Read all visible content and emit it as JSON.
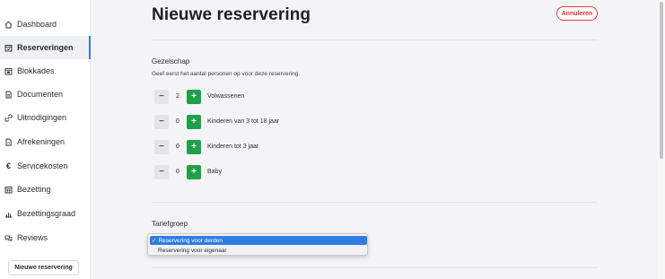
{
  "sidebar": {
    "items": [
      {
        "label": "Dashboard",
        "icon": "home-icon"
      },
      {
        "label": "Reserveringen",
        "icon": "calendar-check-icon"
      },
      {
        "label": "Blokkades",
        "icon": "calendar-block-icon"
      },
      {
        "label": "Documenten",
        "icon": "document-icon"
      },
      {
        "label": "Uitnodigingen",
        "icon": "link-icon"
      },
      {
        "label": "Afrekeningen",
        "icon": "receipt-icon"
      },
      {
        "label": "Servicekosten",
        "icon": "euro-icon"
      },
      {
        "label": "Bezetting",
        "icon": "calendar-grid-icon"
      },
      {
        "label": "Bezettingsgraad",
        "icon": "bar-chart-icon"
      },
      {
        "label": "Reviews",
        "icon": "chat-icon"
      }
    ],
    "new_reservation_label": "Nieuwe reservering"
  },
  "header": {
    "title": "Nieuwe reservering",
    "cancel_label": "Annuleren"
  },
  "gezelschap": {
    "title": "Gezelschap",
    "description": "Geef eerst het aantal personen op voor deze reservering.",
    "counters": [
      {
        "label": "Volwassenen",
        "value": "2"
      },
      {
        "label": "Kinderen van 3 tot 18 jaar",
        "value": "0"
      },
      {
        "label": "Kinderen tot 3 jaar",
        "value": "0"
      },
      {
        "label": "Baby",
        "value": "0"
      }
    ]
  },
  "tariefgroep": {
    "title": "Tariefgroep",
    "options": [
      {
        "label": "Reservering voor derden",
        "selected": true
      },
      {
        "label": "Reservering voor eigenaar",
        "selected": false
      }
    ]
  },
  "colors": {
    "plus_button": "#1fa14a",
    "cancel_border": "#e23b3b",
    "selected_option": "#2f7de1",
    "active_nav_border": "#3c7cc4"
  }
}
